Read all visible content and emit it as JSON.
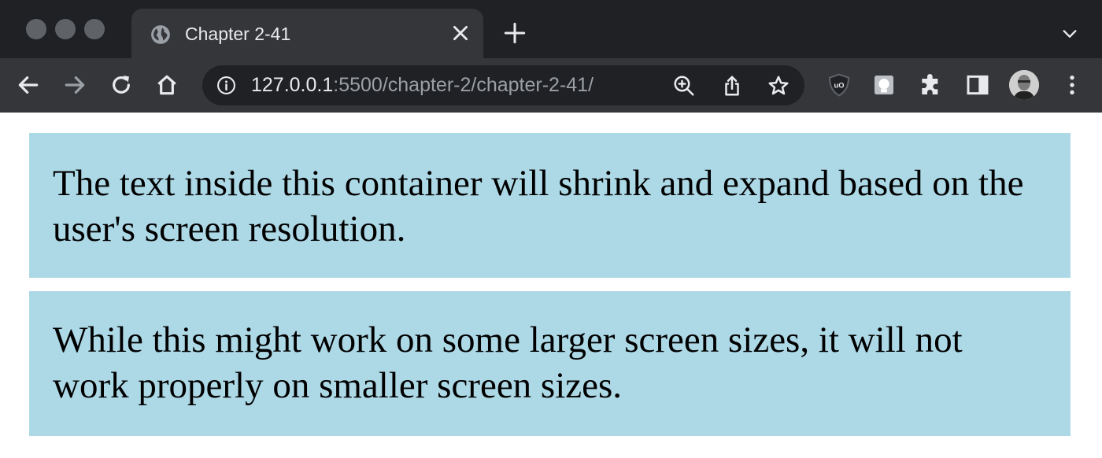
{
  "browser": {
    "tab": {
      "title": "Chapter 2-41",
      "favicon": "globe-icon"
    },
    "url": {
      "host": "127.0.0.1",
      "rest": ":5500/chapter-2/chapter-2-41/"
    },
    "icons": {
      "back": "arrow-left-icon",
      "forward": "arrow-right-icon",
      "reload": "reload-icon",
      "home": "home-icon",
      "zoom": "zoom-in-icon",
      "share": "share-icon",
      "bookmark": "star-icon",
      "extensions": [
        "ublock-icon",
        "extension-square-icon",
        "puzzle-icon",
        "sidebar-icon"
      ],
      "menu": "kebab-menu-icon"
    },
    "colors": {
      "frame": "#202124",
      "toolbar": "#35363a",
      "text": "#e8eaed",
      "dim": "#9aa0a6"
    }
  },
  "page": {
    "background": "#ffffff",
    "box_color": "#add8e6",
    "boxes": [
      {
        "text": "The text inside this container will shrink and expand based on the user's screen resolution."
      },
      {
        "text": "While this might work on some larger screen sizes, it will not work properly on smaller screen sizes."
      }
    ]
  }
}
